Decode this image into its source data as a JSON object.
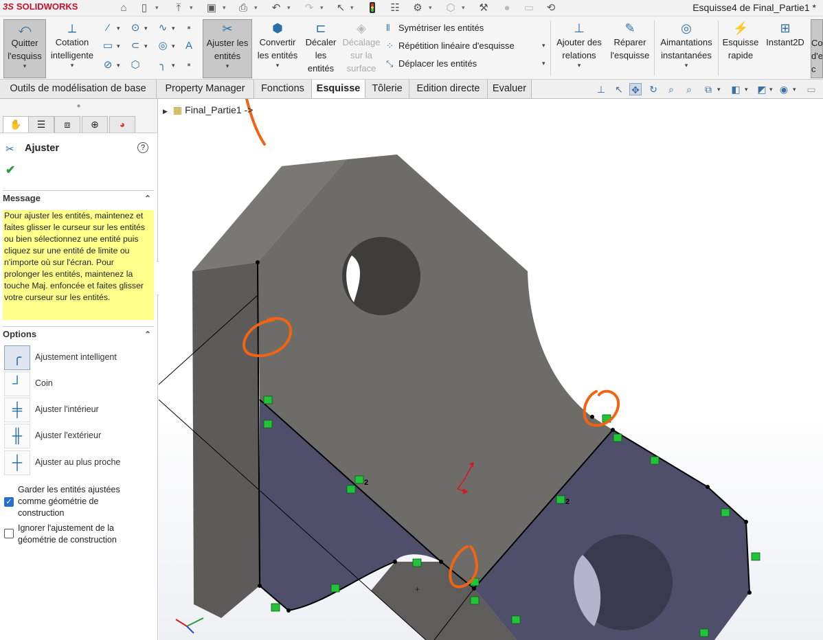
{
  "app": {
    "logo": "SOLIDWORKS",
    "logo_prefix": "3S",
    "window_title": "Esquisse4 de Final_Partie1 *"
  },
  "ribbon": {
    "quit_sketch": "Quitter l'esquisse",
    "quit_sketch_line1": "Quitter",
    "quit_sketch_line2": "l'esquiss",
    "smart_dimension_l1": "Cotation",
    "smart_dimension_l2": "intelligente",
    "trim_l1": "Ajuster les",
    "trim_l2": "entités",
    "convert_l1": "Convertir",
    "convert_l2": "les entités",
    "offset_l1": "Décaler",
    "offset_l2": "les",
    "offset_l3": "entités",
    "offset_surface_l1": "Décalage",
    "offset_surface_l2": "sur la",
    "offset_surface_l3": "surface",
    "mirror": "Symétriser les entités",
    "linear_pattern": "Répétition linéaire d'esquisse",
    "move": "Déplacer les entités",
    "add_relations_l1": "Ajouter des",
    "add_relations_l2": "relations",
    "repair_l1": "Réparer",
    "repair_l2": "l'esquisse",
    "snaps_l1": "Aimantations",
    "snaps_l2": "instantanées",
    "rapid_l1": "Esquisse",
    "rapid_l2": "rapide",
    "instant2d": "Instant2D",
    "overflow_l1": "Co",
    "overflow_l2": "d'e",
    "overflow_l3": "c"
  },
  "tabs": [
    "Outils de modélisation de base",
    "Property Manager",
    "Fonctions",
    "Esquisse",
    "Tôlerie",
    "Edition directe",
    "Evaluer"
  ],
  "active_tab": "Esquisse",
  "tree": {
    "root": "Final_Partie1 ->"
  },
  "property_manager": {
    "title": "Ajuster",
    "help": "?",
    "ok": "✔",
    "message_header": "Message",
    "message": "Pour ajuster les entités, maintenez et faites glisser le curseur sur les entités ou bien sélectionnez une entité puis cliquez sur une entité de limite ou n'importe où sur l'écran. Pour prolonger les entités, maintenez la touche Maj. enfoncée et faites glisser votre curseur sur les entités.",
    "options_header": "Options",
    "options": [
      "Ajustement intelligent",
      "Coin",
      "Ajuster l'intérieur",
      "Ajuster l'extérieur",
      "Ajuster au plus proche"
    ],
    "selected_option": "Ajustement intelligent",
    "checkbox_keep": "Garder les entités ajustées comme géométrie de construction",
    "checkbox_keep_checked": true,
    "checkbox_ignore": "Ignorer l'ajustement de la géométrie de construction",
    "checkbox_ignore_checked": false
  },
  "relation_labels": [
    "2",
    "2"
  ],
  "colors": {
    "annotation": "#f06414",
    "sketch_face": "#4f4f6c",
    "model_face": "#6e6c69",
    "relation_marker": "#22c23a",
    "accent": "#2a6fa8"
  },
  "icons": [
    "home-icon",
    "new-icon",
    "open-icon",
    "save-icon",
    "print-icon",
    "undo-icon",
    "redo-icon",
    "select-icon",
    "rebuild-icon",
    "file-properties-icon",
    "options-icon"
  ]
}
